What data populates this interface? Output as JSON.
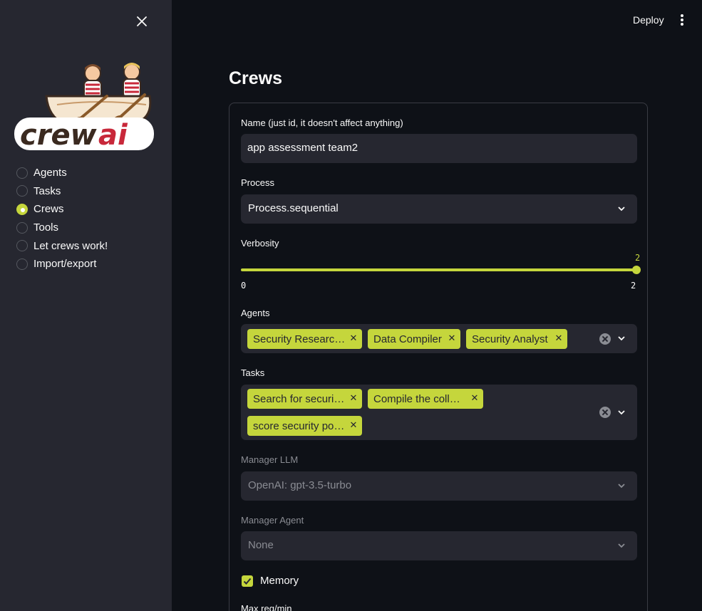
{
  "sidebar": {
    "logo_text": "crewai",
    "nav_items": [
      {
        "label": "Agents",
        "selected": false
      },
      {
        "label": "Tasks",
        "selected": false
      },
      {
        "label": "Crews",
        "selected": true
      },
      {
        "label": "Tools",
        "selected": false
      },
      {
        "label": "Let crews work!",
        "selected": false
      },
      {
        "label": "Import/export",
        "selected": false
      }
    ]
  },
  "topbar": {
    "deploy_label": "Deploy",
    "menu_icon": "kebab-icon"
  },
  "page": {
    "title": "Crews"
  },
  "form": {
    "name": {
      "label": "Name (just id, it doesn't affect anything)",
      "value": "app assessment team2"
    },
    "process": {
      "label": "Process",
      "value": "Process.sequential"
    },
    "verbosity": {
      "label": "Verbosity",
      "value": "2",
      "min": "0",
      "max": "2"
    },
    "agents": {
      "label": "Agents",
      "tags": [
        "Security Researc…",
        "Data Compiler",
        "Security Analyst"
      ]
    },
    "tasks": {
      "label": "Tasks",
      "tags": [
        "Search for securi…",
        "Compile the coll…",
        "score security po…"
      ]
    },
    "manager_llm": {
      "label": "Manager LLM",
      "value": "OpenAI: gpt-3.5-turbo"
    },
    "manager_agent": {
      "label": "Manager Agent",
      "value": "None"
    },
    "memory": {
      "label": "Memory",
      "checked": true
    },
    "max_req": {
      "label": "Max req/min"
    }
  },
  "colors": {
    "accent": "#c5d63c",
    "sidebar_bg": "#262730",
    "main_bg": "#0e1117",
    "field_bg": "#262730"
  }
}
